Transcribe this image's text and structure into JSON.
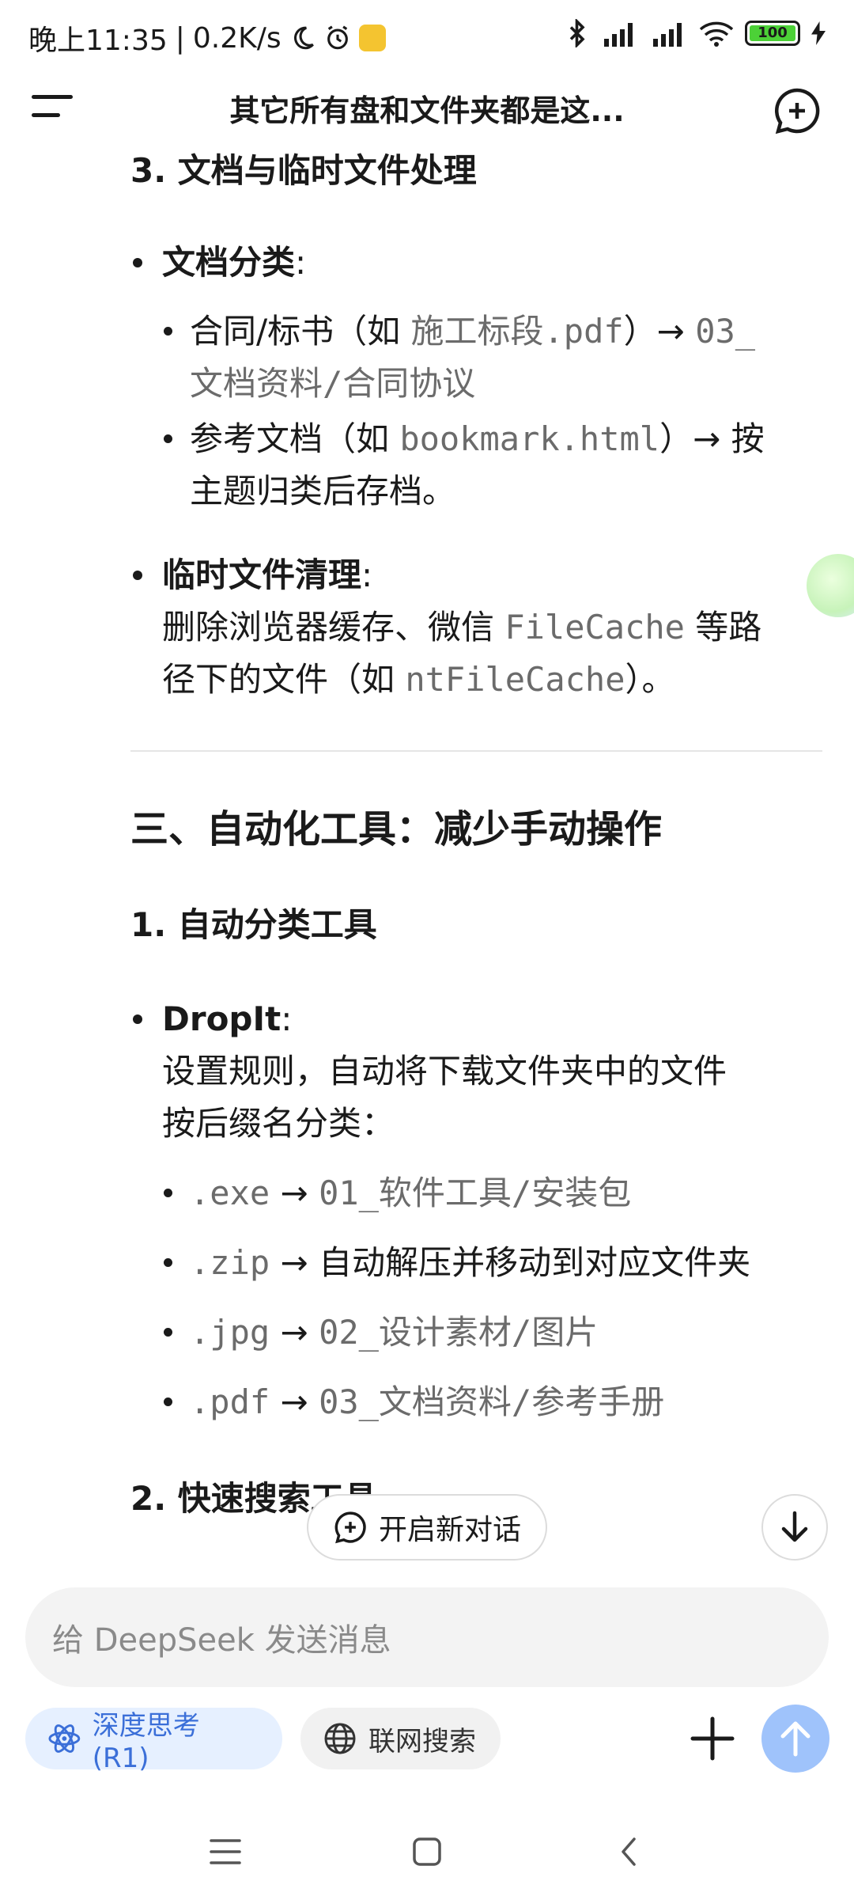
{
  "status_bar": {
    "time": "晚上11:35",
    "net_speed": "0.2K/s",
    "battery": "100"
  },
  "header": {
    "title": "其它所有盘和文件夹都是这..."
  },
  "content": {
    "section3_title": "3. 文档与临时文件处理",
    "doc_class_label": "文档分类",
    "contract_pre": "合同/标书（如 ",
    "contract_code": "施工标段.pdf",
    "contract_mid": "）→ ",
    "contract_path1": "03_",
    "contract_path2": "文档资料/合同协议",
    "ref_pre": "参考文档（如 ",
    "ref_code": "bookmark.html",
    "ref_mid": "）→ 按",
    "ref_rest": "主题归类后存档。",
    "temp_label": "临时文件清理",
    "temp_line1_pre": "删除浏览器缓存、微信 ",
    "temp_line1_code": "FileCache",
    "temp_line1_post": " 等路",
    "temp_line2_pre": "径下的文件（如 ",
    "temp_line2_code": "ntFileCache",
    "temp_line2_post": "）。",
    "part3_title": "三、自动化工具：减少手动操作",
    "tool1_title": "1. 自动分类工具",
    "dropit_label": "DropIt",
    "dropit_line1": "设置规则，自动将下载文件夹中的文件",
    "dropit_line2": "按后缀名分类：",
    "rules": [
      {
        "ext": ".exe",
        "arrow": " → ",
        "target": "01_软件工具/安装包",
        "target_mono": true
      },
      {
        "ext": ".zip",
        "arrow": " → ",
        "target": "自动解压并移动到对应文件夹",
        "target_mono": false
      },
      {
        "ext": ".jpg",
        "arrow": " → ",
        "target": "02_设计素材/图片",
        "target_mono": true
      },
      {
        "ext": ".pdf",
        "arrow": " → ",
        "target": "03_文档资料/参考手册",
        "target_mono": true
      }
    ],
    "tool2_title": "2. 快速搜索工具"
  },
  "floating": {
    "new_chat_label": "开启新对话"
  },
  "input": {
    "placeholder": "给 DeepSeek 发送消息",
    "deep_think_label": "深度思考 (R1)",
    "web_search_label": "联网搜索"
  }
}
